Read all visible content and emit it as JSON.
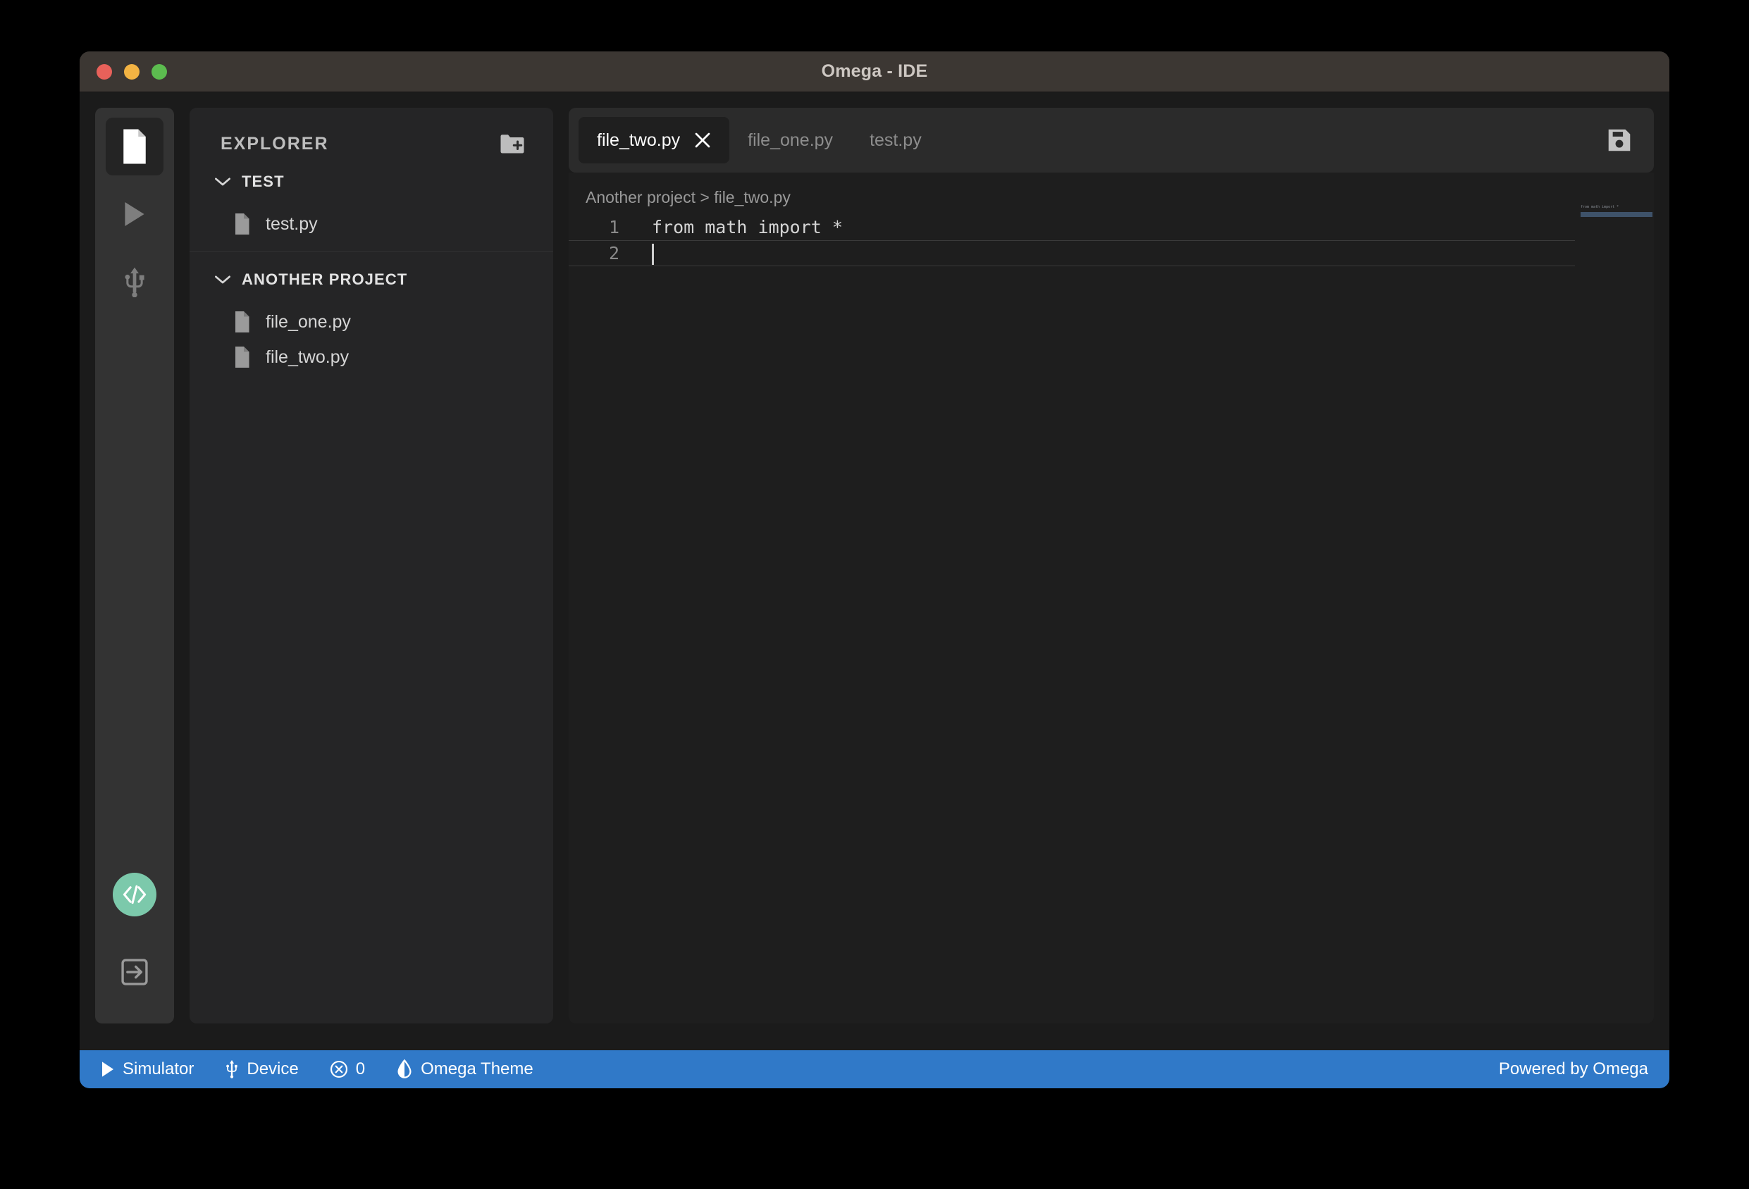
{
  "window": {
    "title": "Omega - IDE",
    "traffic_lights": [
      {
        "name": "close",
        "color": "#e8615a"
      },
      {
        "name": "minimize",
        "color": "#f3b343"
      },
      {
        "name": "zoom",
        "color": "#5cbc4f"
      }
    ]
  },
  "activity_bar": {
    "items": [
      {
        "icon": "file-icon",
        "name": "explorer",
        "active": true
      },
      {
        "icon": "play-icon",
        "name": "run",
        "active": false
      },
      {
        "icon": "usb-icon",
        "name": "device",
        "active": false
      }
    ],
    "bottom": [
      {
        "icon": "code-icon",
        "name": "omega-code",
        "color": "#7cc9ab"
      },
      {
        "icon": "logout-icon",
        "name": "logout"
      }
    ]
  },
  "explorer": {
    "title": "EXPLORER",
    "new_folder_icon": "folder-plus-icon",
    "groups": [
      {
        "label": "TEST",
        "expanded": true,
        "files": [
          {
            "name": "test.py"
          }
        ]
      },
      {
        "label": "ANOTHER PROJECT",
        "expanded": true,
        "files": [
          {
            "name": "file_one.py"
          },
          {
            "name": "file_two.py"
          }
        ]
      }
    ]
  },
  "editor": {
    "tabs": [
      {
        "label": "file_two.py",
        "active": true,
        "closable": true
      },
      {
        "label": "file_one.py",
        "active": false,
        "closable": false
      },
      {
        "label": "test.py",
        "active": false,
        "closable": false
      }
    ],
    "save_icon": "save-icon",
    "breadcrumb": "Another project > file_two.py",
    "lines": [
      {
        "number": "1",
        "text": "from math import *",
        "active": false
      },
      {
        "number": "2",
        "text": "",
        "active": true
      }
    ],
    "minimap": {
      "text": "from math import *"
    }
  },
  "status_bar": {
    "items": [
      {
        "icon": "play-icon",
        "label": "Simulator"
      },
      {
        "icon": "usb-icon",
        "label": "Device"
      },
      {
        "icon": "error-circle-icon",
        "label": "0"
      },
      {
        "icon": "theme-droplet-icon",
        "label": "Omega Theme"
      }
    ],
    "right_label": "Powered by Omega",
    "background": "#3079c8"
  }
}
